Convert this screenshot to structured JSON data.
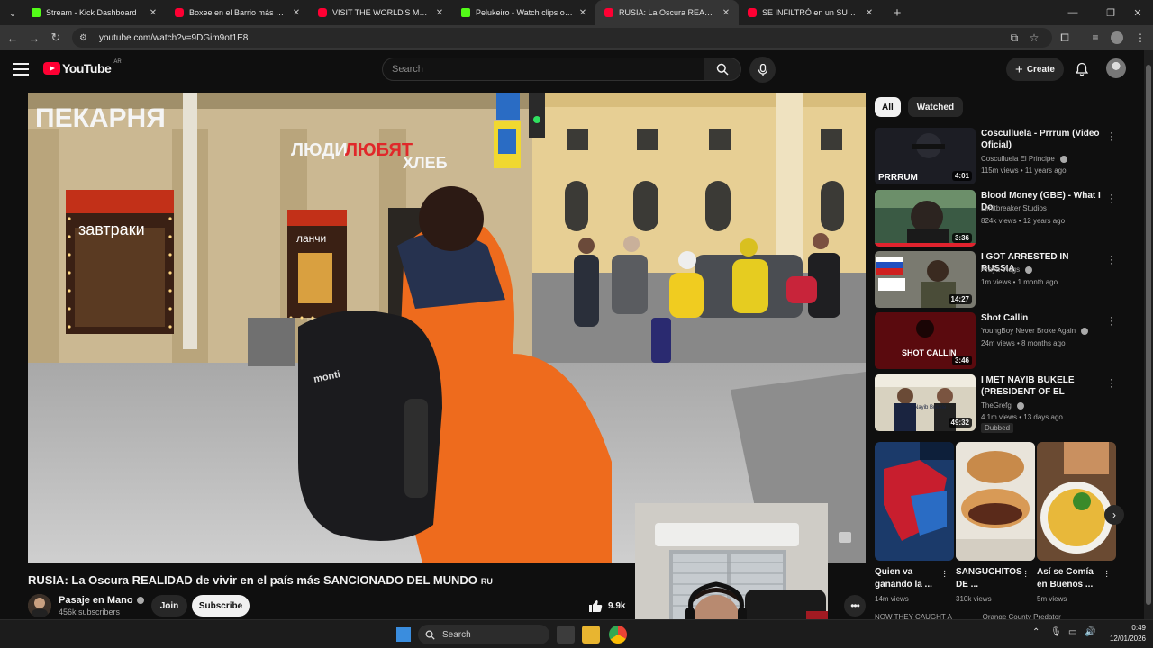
{
  "browser": {
    "tabs": [
      {
        "title": "Stream - Kick Dashboard",
        "favicon": "kick-icon"
      },
      {
        "title": "Boxee en el Barrio más Peligroso",
        "favicon": "youtube-icon"
      },
      {
        "title": "VISIT THE WORLD'S MOST HUNTED",
        "favicon": "youtube-icon"
      },
      {
        "title": "Pelukeiro - Watch clips on Kick",
        "favicon": "kick-icon"
      },
      {
        "title": "RUSIA: La Oscura REALIDAD de vivir",
        "favicon": "youtube-icon",
        "active": true
      },
      {
        "title": "SE INFILTRÓ en un SUBMARINO",
        "favicon": "youtube-icon"
      }
    ],
    "url": "youtube.com/watch?v=9DGim9ot1E8"
  },
  "youtube": {
    "logo_text": "YouTube",
    "country_code": "AR",
    "search_placeholder": "Search",
    "create_label": "Create"
  },
  "video": {
    "title": "RUSIA: La Oscura REALIDAD de vivir en el país más SANCIONADO DEL MUNDO",
    "title_suffix": "RU",
    "channel_name": "Pasaje en Mano",
    "subscribers": "456k subscribers",
    "join_label": "Join",
    "subscribe_label": "Subscribe",
    "likes": "9.9k",
    "signs": {
      "bakery": "ПЕКАРНЯ",
      "people": "ЛЮДИ",
      "love": "ЛЮБЯТ",
      "bread": "ХЛЕБ",
      "breakfast": "завтраки",
      "lunch": "ланчи",
      "backpack_brand": "monti"
    }
  },
  "sidebar": {
    "chips": [
      {
        "label": "All",
        "active": true
      },
      {
        "label": "Watched",
        "active": false
      }
    ],
    "recommendations": [
      {
        "title": "Cosculluela - Prrrum (Video Oficial)",
        "channel": "Cosculluela El Principe",
        "meta": "115m views • 11 years ago",
        "duration": "4:01",
        "thumb_text": "PRRRUM",
        "verified": true
      },
      {
        "title": "Blood Money (GBE) - What I Do",
        "channel": "Limitbreaker Studios",
        "meta": "824k views • 12 years ago",
        "duration": "3:36",
        "verified": false
      },
      {
        "title": "I GOT ARRESTED IN RUSSIA",
        "channel": "Araya Vlogs",
        "meta": "1m views • 1 month ago",
        "duration": "14:27",
        "verified": true
      },
      {
        "title": "Shot Callin",
        "channel": "YoungBoy Never Broke Again",
        "meta": "24m views • 8 months ago",
        "duration": "3:46",
        "thumb_text": "SHOT CALLIN",
        "verified": true
      },
      {
        "title": "I MET NAYIB BUKELE (PRESIDENT OF EL SALVADOR)",
        "channel": "TheGrefg",
        "meta": "4.1m views • 13 days ago",
        "duration": "49:32",
        "badge": "Dubbed",
        "thumb_text": "Nayib Bukele",
        "verified": true
      }
    ],
    "shorts": [
      {
        "title": "Quien va ganando la ...",
        "views": "14m views"
      },
      {
        "title": "SANGUCHITOS DE ...",
        "views": "310k views"
      },
      {
        "title": "Así se Comía en Buenos ...",
        "views": "5m views"
      }
    ],
    "peek": [
      "NOW THEY CAUGHT A",
      "Orange County Predator"
    ]
  },
  "taskbar": {
    "search_label": "Search",
    "time": "0:49",
    "date": "12/01/2026"
  }
}
